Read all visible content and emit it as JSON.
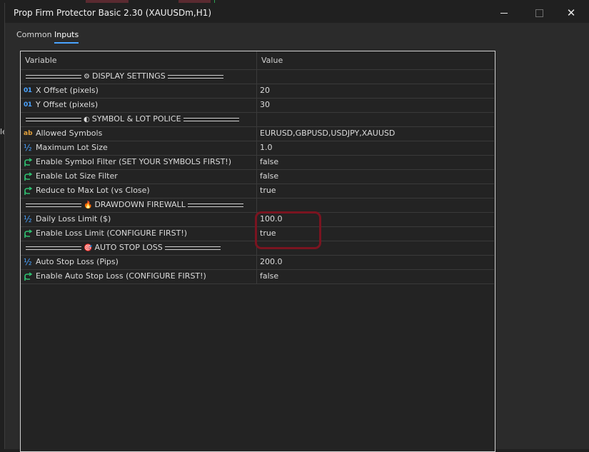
{
  "window": {
    "title": "Prop Firm Protector Basic 2.30 (XAUUSDm,H1)",
    "minimize_icon": "minimize-icon",
    "maximize_icon": "maximize-icon",
    "close_icon": "close-icon",
    "close_glyph": "✕"
  },
  "background": {
    "edge_text": "le"
  },
  "tabs": [
    {
      "label": "Common",
      "active": false
    },
    {
      "label": "Inputs",
      "active": true
    }
  ],
  "table": {
    "headers": {
      "variable": "Variable",
      "value": "Value"
    },
    "rows": [
      {
        "kind": "section",
        "glyph": "⚙",
        "label": "DISPLAY SETTINGS"
      },
      {
        "kind": "param",
        "type": "int",
        "icon": "integer-icon",
        "name": "X Offset (pixels)",
        "value": "20"
      },
      {
        "kind": "param",
        "type": "int",
        "icon": "integer-icon",
        "name": "Y Offset (pixels)",
        "value": "30"
      },
      {
        "kind": "section",
        "glyph": "◐",
        "label": "SYMBOL & LOT POLICE"
      },
      {
        "kind": "param",
        "type": "string",
        "icon": "string-icon",
        "name": "Allowed Symbols",
        "value": "EURUSD,GBPUSD,USDJPY,XAUUSD"
      },
      {
        "kind": "param",
        "type": "double",
        "icon": "double-icon",
        "name": "Maximum Lot Size",
        "value": "1.0"
      },
      {
        "kind": "param",
        "type": "bool",
        "icon": "bool-icon",
        "name": "Enable Symbol Filter (SET YOUR SYMBOLS FIRST!)",
        "value": "false"
      },
      {
        "kind": "param",
        "type": "bool",
        "icon": "bool-icon",
        "name": "Enable Lot Size Filter",
        "value": "false"
      },
      {
        "kind": "param",
        "type": "bool",
        "icon": "bool-icon",
        "name": "Reduce to Max Lot (vs Close)",
        "value": "true"
      },
      {
        "kind": "section",
        "glyph": "🔥",
        "label": "DRAWDOWN FIREWALL"
      },
      {
        "kind": "param",
        "type": "double",
        "icon": "double-icon",
        "name": "Daily Loss Limit ($)",
        "value": "100.0"
      },
      {
        "kind": "param",
        "type": "bool",
        "icon": "bool-icon",
        "name": "Enable Loss Limit (CONFIGURE FIRST!)",
        "value": "true"
      },
      {
        "kind": "section",
        "glyph": "🎯",
        "label": "AUTO STOP LOSS"
      },
      {
        "kind": "param",
        "type": "double",
        "icon": "double-icon",
        "name": "Auto Stop Loss (Pips)",
        "value": "200.0"
      },
      {
        "kind": "param",
        "type": "bool",
        "icon": "bool-icon",
        "name": "Enable Auto Stop Loss (CONFIGURE FIRST!)",
        "value": "false"
      }
    ]
  },
  "icon_glyphs": {
    "int": "01",
    "string": "ab",
    "double": "½"
  },
  "colors": {
    "accent": "#4aa3ff",
    "bool_icon": "#2fbf71",
    "string_icon": "#e3a13b",
    "highlight_annotation": "#7a1420"
  }
}
